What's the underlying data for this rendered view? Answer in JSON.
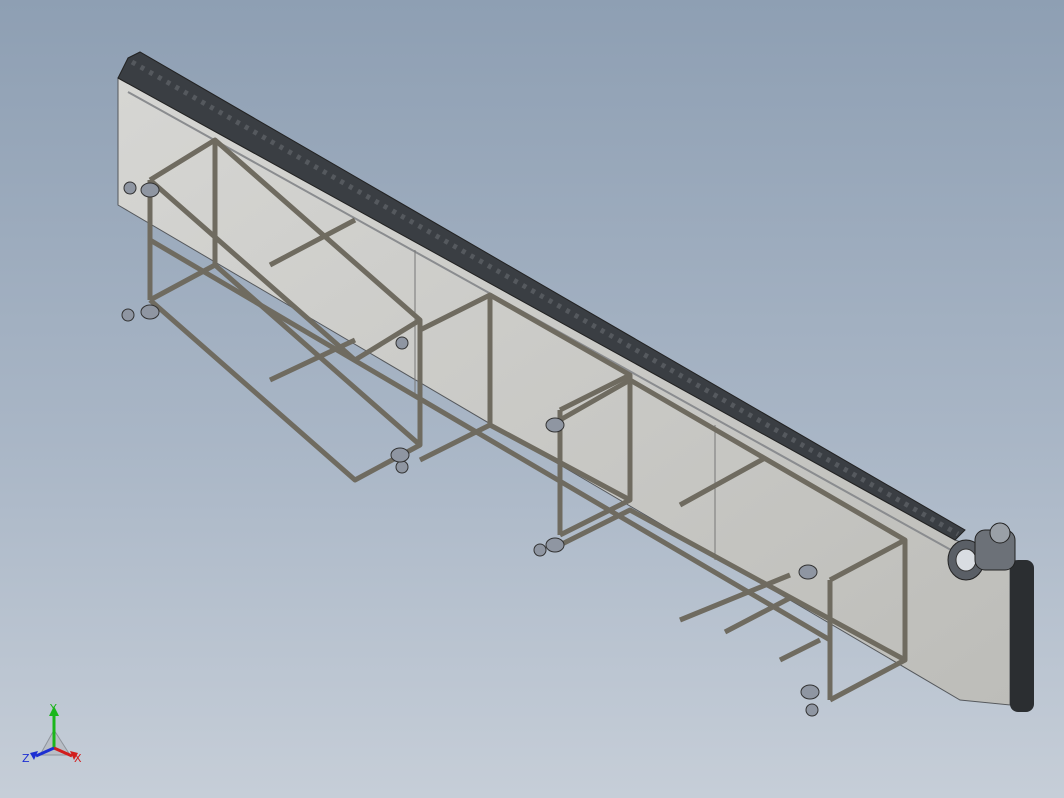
{
  "viewport": {
    "background_top": "#8e9fb3",
    "background_bottom": "#c6ced8"
  },
  "model": {
    "panel_color": "#cfcfcc",
    "frame_color": "#6f6b60",
    "chain_color": "#2f3337",
    "caster_color": "#8f96a2"
  },
  "triad": {
    "x_label": "X",
    "y_label": "Y",
    "z_label": "Z",
    "x_color": "#d21d1d",
    "y_color": "#1bb61b",
    "z_color": "#1d2fd2"
  }
}
